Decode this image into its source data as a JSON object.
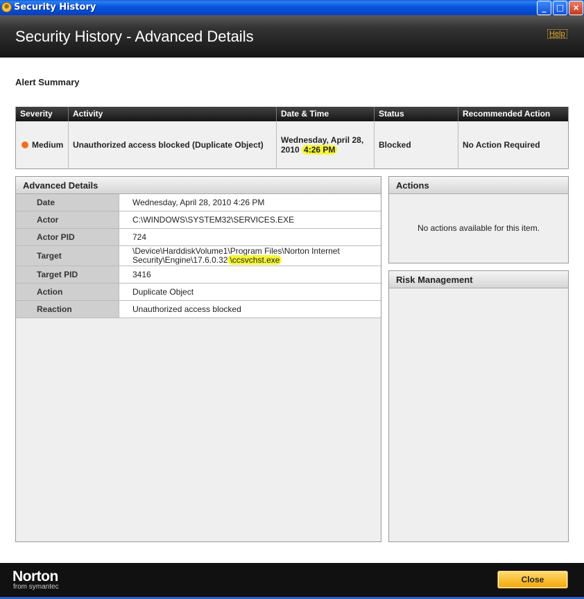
{
  "window": {
    "title": "Security History",
    "icon": "norton-globe-icon",
    "buttons": {
      "minimize": "_",
      "maximize": "□",
      "close": "×"
    }
  },
  "header": {
    "title": "Security History - Advanced Details",
    "help_label": "Help"
  },
  "alert_summary": {
    "heading": "Alert Summary",
    "columns": [
      "Severity",
      "Activity",
      "Date & Time",
      "Status",
      "Recommended Action"
    ],
    "row": {
      "severity": "Medium",
      "severity_color": "#f07020",
      "activity": "Unauthorized access blocked (Duplicate Object)",
      "date_prefix": "Wednesday, April 28, 2010",
      "date_highlight": "4:26 PM",
      "status": "Blocked",
      "recommended_action": "No Action Required"
    }
  },
  "advanced_details": {
    "heading": "Advanced Details",
    "rows": [
      {
        "label": "Date",
        "value": "Wednesday, April 28, 2010 4:26 PM"
      },
      {
        "label": "Actor",
        "value": "C:\\WINDOWS\\SYSTEM32\\SERVICES.EXE"
      },
      {
        "label": "Actor PID",
        "value": "724"
      },
      {
        "label": "Target",
        "value_prefix": "\\Device\\HarddiskVolume1\\Program Files\\Norton Internet Security\\Engine\\17.6.0.32",
        "value_highlight": "\\ccsvchst.exe"
      },
      {
        "label": "Target PID",
        "value": "3416"
      },
      {
        "label": "Action",
        "value": "Duplicate Object"
      },
      {
        "label": "Reaction",
        "value": "Unauthorized access blocked"
      }
    ]
  },
  "actions": {
    "heading": "Actions",
    "message": "No actions available for this item."
  },
  "risk_management": {
    "heading": "Risk Management"
  },
  "footer": {
    "logo": "Norton",
    "logo_sub": "from symantec",
    "close_label": "Close"
  },
  "colors": {
    "highlight": "#f5f53a",
    "close_button": "#f4a80a",
    "title_bar": "#0855dd"
  }
}
